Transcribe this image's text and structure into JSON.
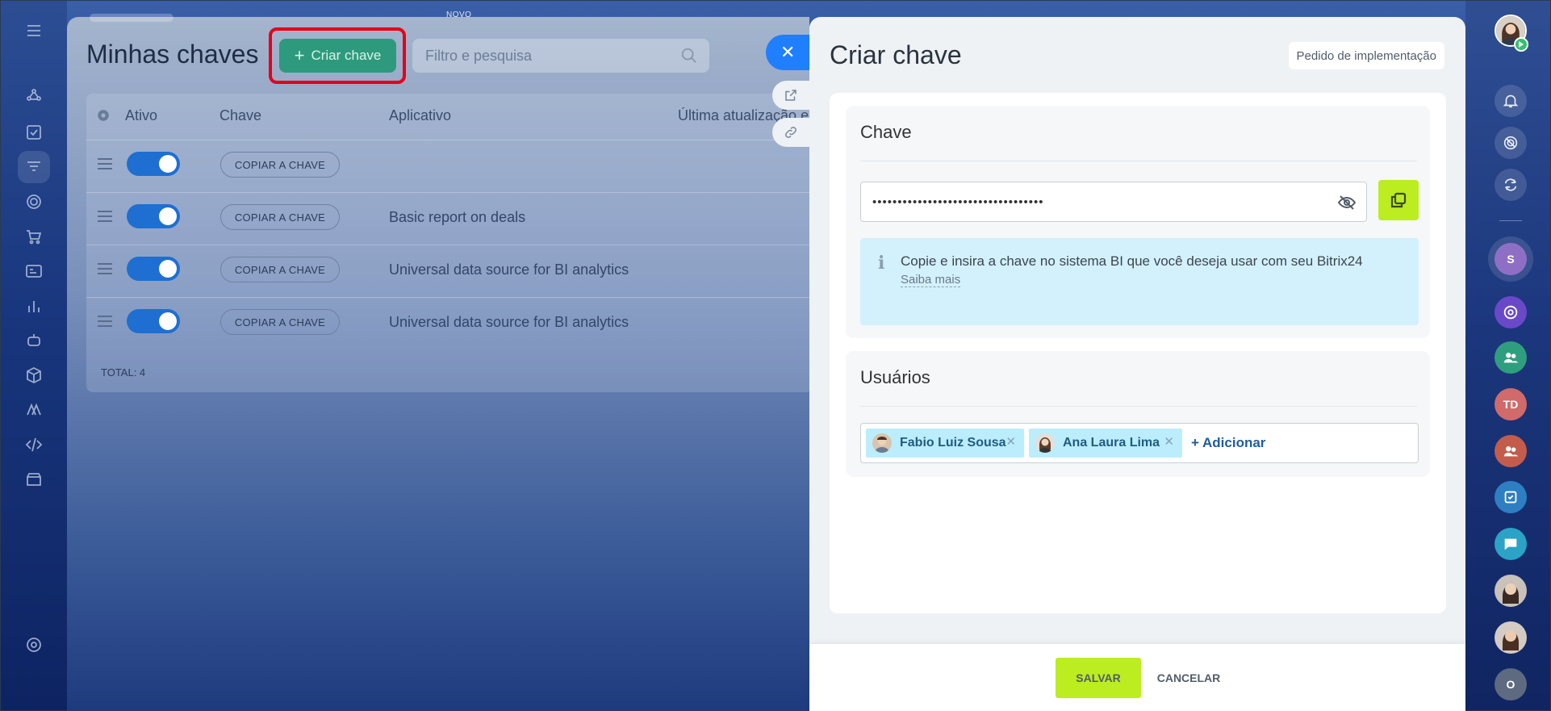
{
  "list": {
    "new_tag": "NOVO",
    "title": "Minhas chaves",
    "create_button": "Criar chave",
    "search_placeholder": "Filtro e pesquisa",
    "headers": [
      "Ativo",
      "Chave",
      "Aplicativo",
      "Última atualização em"
    ],
    "rows": [
      {
        "copy_label": "COPIAR A CHAVE",
        "app": ""
      },
      {
        "copy_label": "COPIAR A CHAVE",
        "app": "Basic report on deals"
      },
      {
        "copy_label": "COPIAR A CHAVE",
        "app": "Universal data source for BI analytics"
      },
      {
        "copy_label": "COPIAR A CHAVE",
        "app": "Universal data source for BI analytics"
      }
    ],
    "total_label": "TOTAL: 4"
  },
  "slider": {
    "title": "Criar chave",
    "implementation_button": "Pedido de implementação",
    "key_section": {
      "title": "Chave",
      "masked_value": "••••••••••••••••••••••••••••••••••",
      "info_text": "Copie e insira a chave no sistema BI que você deseja usar com seu Bitrix24",
      "info_link": "Saiba mais"
    },
    "users_section": {
      "title": "Usuários",
      "users": [
        "Fabio Luiz Sousa",
        "Ana Laura Lima"
      ],
      "add_label": "+ Adicionar"
    },
    "save_button": "SALVAR",
    "cancel_button": "CANCELAR"
  },
  "right_rail": {
    "initials": [
      "S",
      "TD",
      "O"
    ]
  },
  "colors": {
    "accent_green": "#bbed21",
    "create_button": "#2e9a7d",
    "toggle_on": "#1e6fd1",
    "highlight": "#e3001b",
    "info_bg": "#d3f1fc"
  }
}
